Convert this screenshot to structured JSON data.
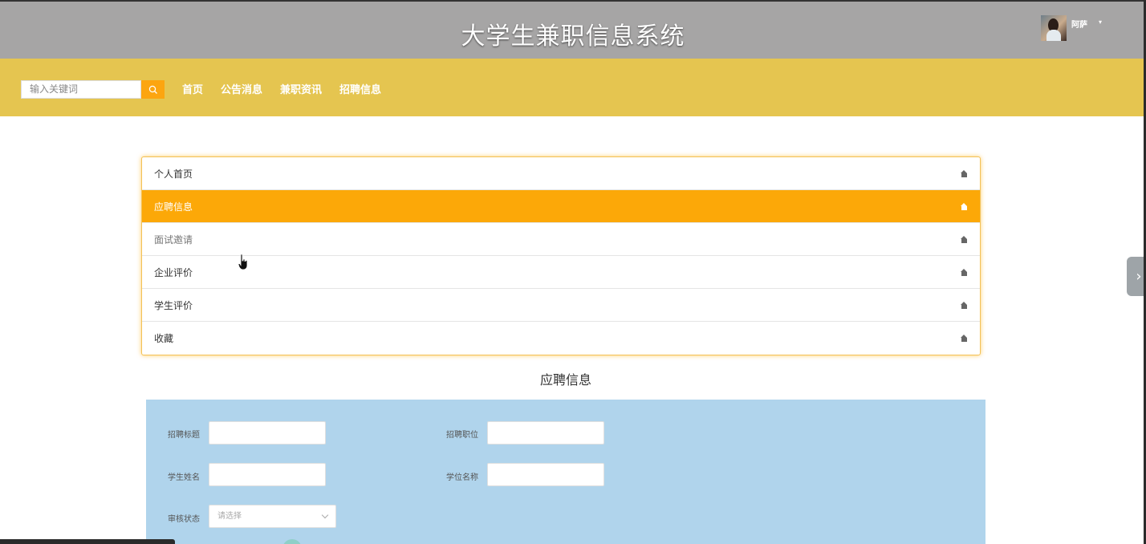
{
  "header": {
    "title": "大学生兼职信息系统",
    "user_name": "阿萨",
    "caret": "▾"
  },
  "nav": {
    "search_placeholder": "输入关键词",
    "links": [
      "首页",
      "公告消息",
      "兼职资讯",
      "招聘信息"
    ]
  },
  "menu": {
    "items": [
      {
        "label": "个人首页",
        "active": false
      },
      {
        "label": "应聘信息",
        "active": true
      },
      {
        "label": "面试邀请",
        "active": false
      },
      {
        "label": "企业评价",
        "active": false
      },
      {
        "label": "学生评价",
        "active": false
      },
      {
        "label": "收藏",
        "active": false
      }
    ]
  },
  "section": {
    "title": "应聘信息"
  },
  "filters": {
    "recruit_title_label": "招聘标题",
    "recruit_position_label": "招聘职位",
    "student_name_label": "学生姓名",
    "degree_name_label": "学位名称",
    "review_status_label": "审核状态",
    "review_status_placeholder": "请选择"
  },
  "side_tab": {
    "glyph": "›"
  },
  "status_bar": {
    "text": ""
  },
  "colors": {
    "topbar": "#a6a5a5",
    "navbar": "#e5c550",
    "accent": "#fca808",
    "panel": "#b0d4ec"
  }
}
